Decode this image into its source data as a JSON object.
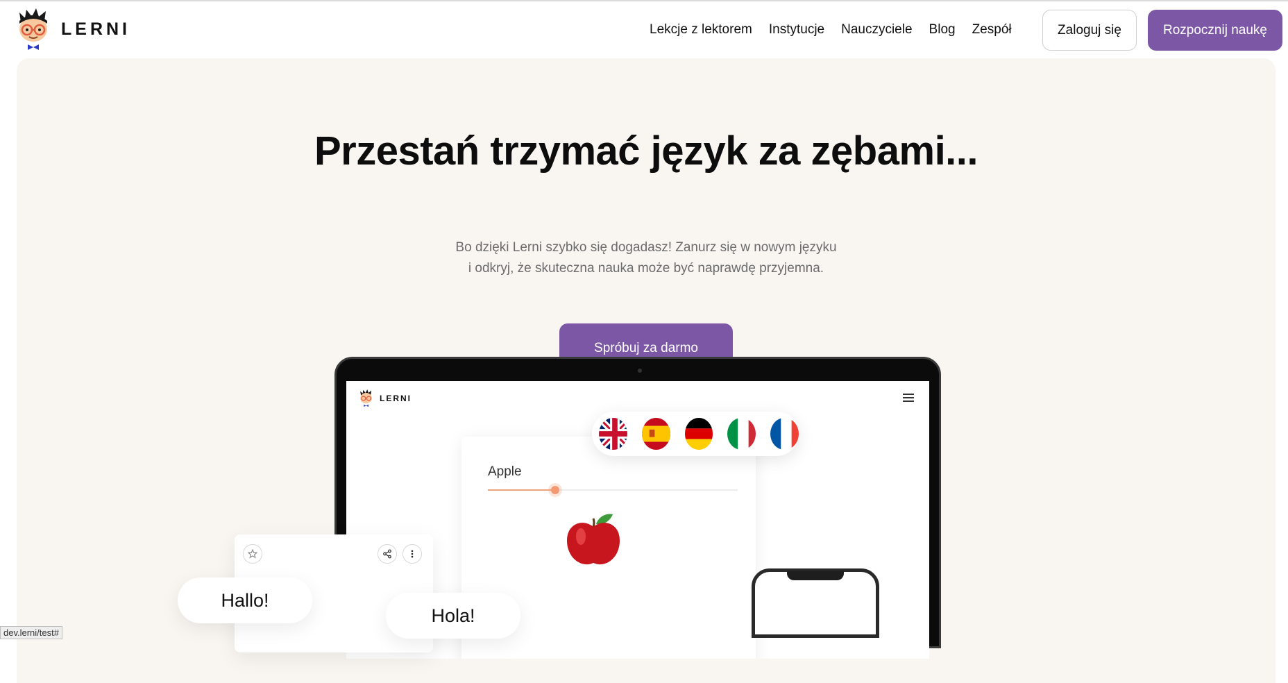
{
  "brand": {
    "name": "LERNI",
    "accent": "#7b57a6"
  },
  "nav": {
    "links": [
      "Lekcje z lektorem",
      "Instytucje",
      "Nauczyciele",
      "Blog",
      "Zespół"
    ],
    "login_label": "Zaloguj się",
    "start_label": "Rozpocznij naukę"
  },
  "hero": {
    "title": "Przestań trzymać język za zębami...",
    "subtitle_line1": "Bo dzięki Lerni szybko się dogadasz! Zanurz się w nowym języku",
    "subtitle_line2": "i odkryj, że skuteczna nauka może być naprawdę przyjemna.",
    "cta_label": "Spróbuj za darmo"
  },
  "mockup": {
    "logo_text": "LERNI",
    "word": "Apple",
    "progress": 0.27,
    "flags": [
      "uk-flag-icon",
      "spain-flag-icon",
      "germany-flag-icon",
      "italy-flag-icon",
      "france-flag-icon"
    ],
    "bubbles": [
      "Hallo!",
      "Hola!"
    ],
    "card_icons": [
      "star-icon",
      "share-icon",
      "more-vertical-icon"
    ]
  },
  "status_bar": {
    "url": "dev.lerni/test#"
  }
}
